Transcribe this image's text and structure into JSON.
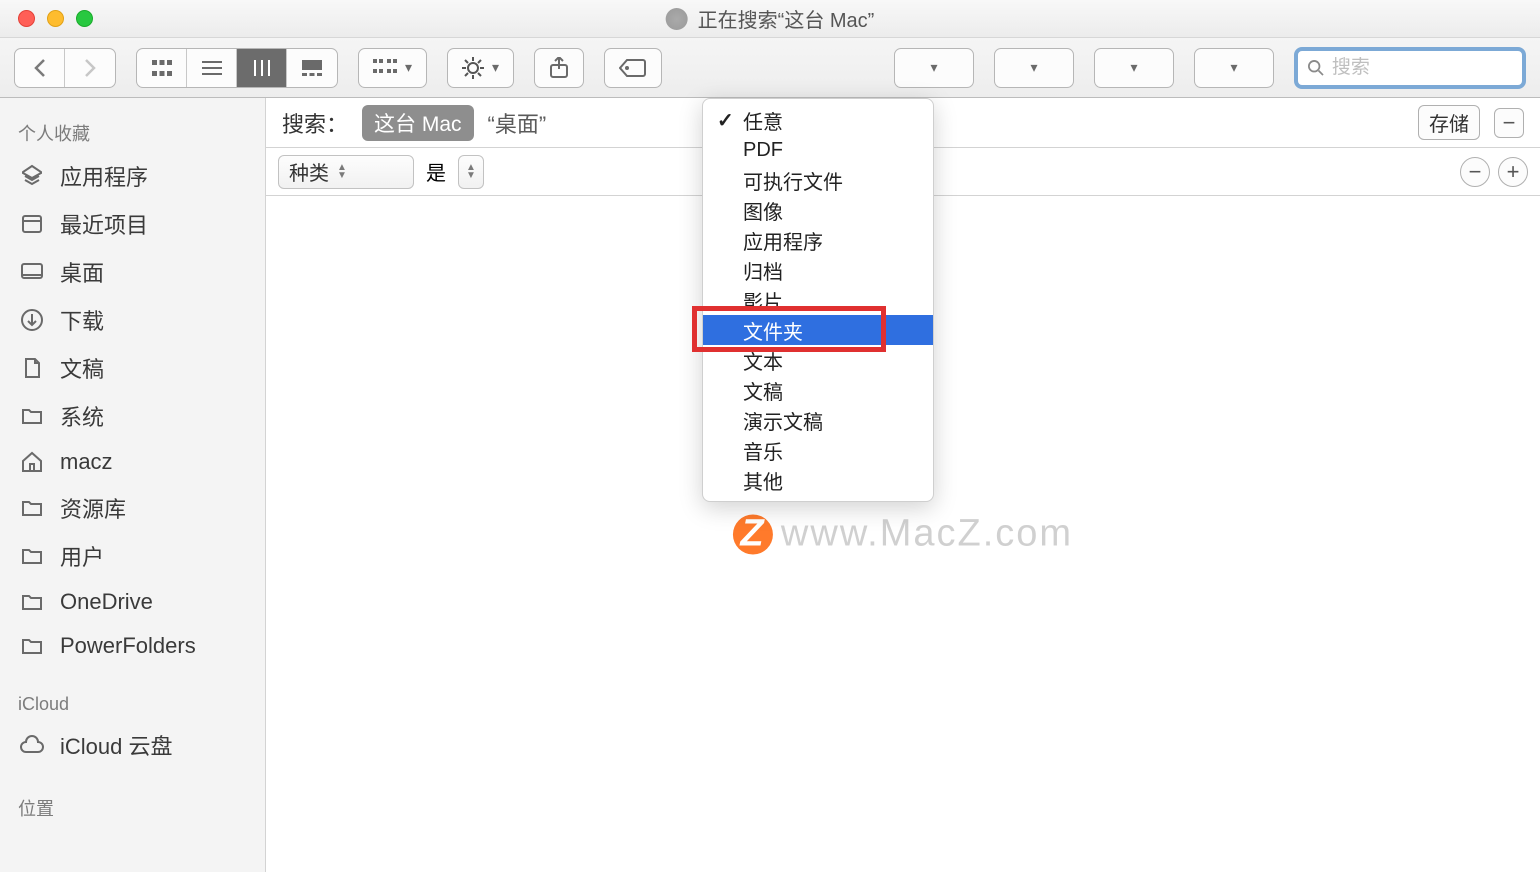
{
  "window": {
    "title": "正在搜索“这台 Mac”"
  },
  "search": {
    "placeholder": "搜索",
    "value": ""
  },
  "sidebar": {
    "sections": [
      {
        "header": "个人收藏",
        "items": [
          {
            "label": "应用程序",
            "icon": "apps"
          },
          {
            "label": "最近项目",
            "icon": "recents"
          },
          {
            "label": "桌面",
            "icon": "desktop"
          },
          {
            "label": "下载",
            "icon": "downloads"
          },
          {
            "label": "文稿",
            "icon": "documents"
          },
          {
            "label": "系统",
            "icon": "folder"
          },
          {
            "label": "macz",
            "icon": "home"
          },
          {
            "label": "资源库",
            "icon": "folder"
          },
          {
            "label": "用户",
            "icon": "folder"
          },
          {
            "label": "OneDrive",
            "icon": "folder"
          },
          {
            "label": "PowerFolders",
            "icon": "folder"
          }
        ]
      },
      {
        "header": "iCloud",
        "items": [
          {
            "label": "iCloud 云盘",
            "icon": "cloud"
          }
        ]
      },
      {
        "header": "位置",
        "items": []
      }
    ]
  },
  "searchbar": {
    "label": "搜索：",
    "scope_active": "这台 Mac",
    "scope_other": "“桌面”",
    "save": "存储"
  },
  "criteria": {
    "attr_select": "种类",
    "is_label": "是"
  },
  "dropdown": {
    "items": [
      "任意",
      "PDF",
      "可执行文件",
      "图像",
      "应用程序",
      "归档",
      "影片",
      "文件夹",
      "文本",
      "文稿",
      "演示文稿",
      "音乐",
      "其他"
    ],
    "checked_index": 0,
    "selected_index": 7
  },
  "watermark": "www.MacZ.com"
}
